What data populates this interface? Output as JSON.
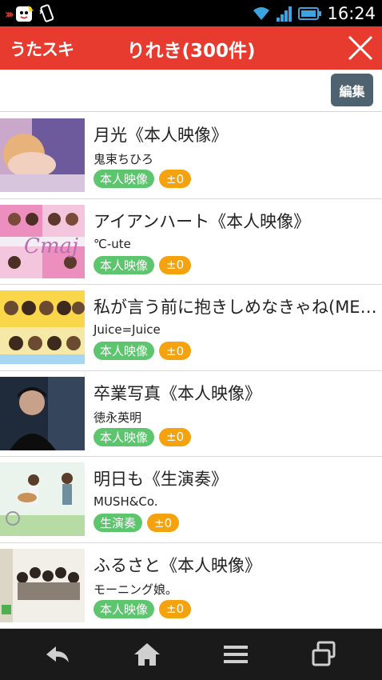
{
  "status_bar": {
    "time": "16:24"
  },
  "header": {
    "logo": "うたスキ",
    "title": "りれき(300件)"
  },
  "toolbar": {
    "edit_label": "編集"
  },
  "items": [
    {
      "title": "月光《本人映像》",
      "artist": "鬼束ちひろ",
      "type_tag": "本人映像",
      "key_tag": "±0"
    },
    {
      "title": "アイアンハート《本人映像》",
      "artist": "℃-ute",
      "type_tag": "本人映像",
      "key_tag": "±0"
    },
    {
      "title": "私が言う前に抱きしめなきゃね(ME…",
      "artist": "Juice=Juice",
      "type_tag": "本人映像",
      "key_tag": "±0"
    },
    {
      "title": "卒業写真《本人映像》",
      "artist": "徳永英明",
      "type_tag": "本人映像",
      "key_tag": "±0"
    },
    {
      "title": "明日も《生演奏》",
      "artist": "MUSH&Co.",
      "type_tag": "生演奏",
      "key_tag": "±0"
    },
    {
      "title": "ふるさと《本人映像》",
      "artist": "モーニング娘。",
      "type_tag": "本人映像",
      "key_tag": "±0"
    }
  ],
  "colors": {
    "header_bg": "#e63b2e",
    "edit_button_bg": "#4f6270",
    "tag_green": "#5cc56d",
    "tag_orange": "#f5a20f",
    "nav_bg": "#1a1a1a"
  },
  "icons": {
    "close": "close-icon",
    "back": "back-icon",
    "home": "home-icon",
    "menu": "menu-icon",
    "recent_apps": "recent-apps-icon"
  }
}
